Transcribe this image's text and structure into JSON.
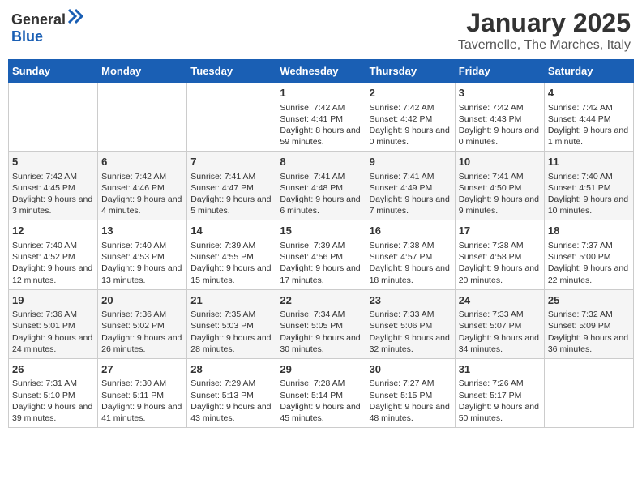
{
  "header": {
    "logo_general": "General",
    "logo_blue": "Blue",
    "title": "January 2025",
    "subtitle": "Tavernelle, The Marches, Italy"
  },
  "days_of_week": [
    "Sunday",
    "Monday",
    "Tuesday",
    "Wednesday",
    "Thursday",
    "Friday",
    "Saturday"
  ],
  "weeks": [
    [
      {
        "day": "",
        "info": ""
      },
      {
        "day": "",
        "info": ""
      },
      {
        "day": "",
        "info": ""
      },
      {
        "day": "1",
        "info": "Sunrise: 7:42 AM\nSunset: 4:41 PM\nDaylight: 8 hours and 59 minutes."
      },
      {
        "day": "2",
        "info": "Sunrise: 7:42 AM\nSunset: 4:42 PM\nDaylight: 9 hours and 0 minutes."
      },
      {
        "day": "3",
        "info": "Sunrise: 7:42 AM\nSunset: 4:43 PM\nDaylight: 9 hours and 0 minutes."
      },
      {
        "day": "4",
        "info": "Sunrise: 7:42 AM\nSunset: 4:44 PM\nDaylight: 9 hours and 1 minute."
      }
    ],
    [
      {
        "day": "5",
        "info": "Sunrise: 7:42 AM\nSunset: 4:45 PM\nDaylight: 9 hours and 3 minutes."
      },
      {
        "day": "6",
        "info": "Sunrise: 7:42 AM\nSunset: 4:46 PM\nDaylight: 9 hours and 4 minutes."
      },
      {
        "day": "7",
        "info": "Sunrise: 7:41 AM\nSunset: 4:47 PM\nDaylight: 9 hours and 5 minutes."
      },
      {
        "day": "8",
        "info": "Sunrise: 7:41 AM\nSunset: 4:48 PM\nDaylight: 9 hours and 6 minutes."
      },
      {
        "day": "9",
        "info": "Sunrise: 7:41 AM\nSunset: 4:49 PM\nDaylight: 9 hours and 7 minutes."
      },
      {
        "day": "10",
        "info": "Sunrise: 7:41 AM\nSunset: 4:50 PM\nDaylight: 9 hours and 9 minutes."
      },
      {
        "day": "11",
        "info": "Sunrise: 7:40 AM\nSunset: 4:51 PM\nDaylight: 9 hours and 10 minutes."
      }
    ],
    [
      {
        "day": "12",
        "info": "Sunrise: 7:40 AM\nSunset: 4:52 PM\nDaylight: 9 hours and 12 minutes."
      },
      {
        "day": "13",
        "info": "Sunrise: 7:40 AM\nSunset: 4:53 PM\nDaylight: 9 hours and 13 minutes."
      },
      {
        "day": "14",
        "info": "Sunrise: 7:39 AM\nSunset: 4:55 PM\nDaylight: 9 hours and 15 minutes."
      },
      {
        "day": "15",
        "info": "Sunrise: 7:39 AM\nSunset: 4:56 PM\nDaylight: 9 hours and 17 minutes."
      },
      {
        "day": "16",
        "info": "Sunrise: 7:38 AM\nSunset: 4:57 PM\nDaylight: 9 hours and 18 minutes."
      },
      {
        "day": "17",
        "info": "Sunrise: 7:38 AM\nSunset: 4:58 PM\nDaylight: 9 hours and 20 minutes."
      },
      {
        "day": "18",
        "info": "Sunrise: 7:37 AM\nSunset: 5:00 PM\nDaylight: 9 hours and 22 minutes."
      }
    ],
    [
      {
        "day": "19",
        "info": "Sunrise: 7:36 AM\nSunset: 5:01 PM\nDaylight: 9 hours and 24 minutes."
      },
      {
        "day": "20",
        "info": "Sunrise: 7:36 AM\nSunset: 5:02 PM\nDaylight: 9 hours and 26 minutes."
      },
      {
        "day": "21",
        "info": "Sunrise: 7:35 AM\nSunset: 5:03 PM\nDaylight: 9 hours and 28 minutes."
      },
      {
        "day": "22",
        "info": "Sunrise: 7:34 AM\nSunset: 5:05 PM\nDaylight: 9 hours and 30 minutes."
      },
      {
        "day": "23",
        "info": "Sunrise: 7:33 AM\nSunset: 5:06 PM\nDaylight: 9 hours and 32 minutes."
      },
      {
        "day": "24",
        "info": "Sunrise: 7:33 AM\nSunset: 5:07 PM\nDaylight: 9 hours and 34 minutes."
      },
      {
        "day": "25",
        "info": "Sunrise: 7:32 AM\nSunset: 5:09 PM\nDaylight: 9 hours and 36 minutes."
      }
    ],
    [
      {
        "day": "26",
        "info": "Sunrise: 7:31 AM\nSunset: 5:10 PM\nDaylight: 9 hours and 39 minutes."
      },
      {
        "day": "27",
        "info": "Sunrise: 7:30 AM\nSunset: 5:11 PM\nDaylight: 9 hours and 41 minutes."
      },
      {
        "day": "28",
        "info": "Sunrise: 7:29 AM\nSunset: 5:13 PM\nDaylight: 9 hours and 43 minutes."
      },
      {
        "day": "29",
        "info": "Sunrise: 7:28 AM\nSunset: 5:14 PM\nDaylight: 9 hours and 45 minutes."
      },
      {
        "day": "30",
        "info": "Sunrise: 7:27 AM\nSunset: 5:15 PM\nDaylight: 9 hours and 48 minutes."
      },
      {
        "day": "31",
        "info": "Sunrise: 7:26 AM\nSunset: 5:17 PM\nDaylight: 9 hours and 50 minutes."
      },
      {
        "day": "",
        "info": ""
      }
    ]
  ]
}
